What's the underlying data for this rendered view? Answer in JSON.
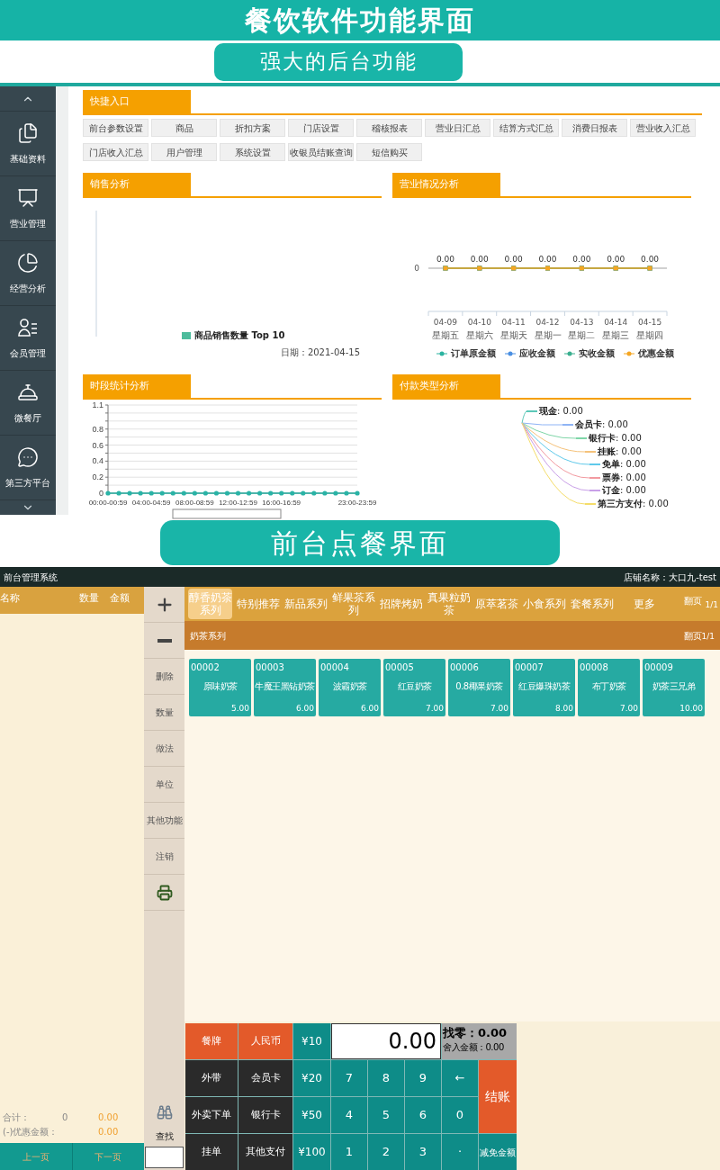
{
  "banner": {
    "title": "餐饮软件功能界面"
  },
  "backoffice_heading": "强大的后台功能",
  "backoffice": {
    "sidebar": {
      "items": [
        {
          "label": "基础资料",
          "kind": "files"
        },
        {
          "label": "营业管理",
          "kind": "board"
        },
        {
          "label": "经营分析",
          "kind": "pie"
        },
        {
          "label": "会员管理",
          "kind": "members"
        },
        {
          "label": "微餐厅",
          "kind": "cloche"
        },
        {
          "label": "第三方平台",
          "kind": "chat"
        }
      ]
    },
    "quick_entry": {
      "title": "快捷入口",
      "buttons": [
        "前台参数设置",
        "商品",
        "折扣方案",
        "门店设置",
        "稽核报表",
        "营业日汇总",
        "结算方式汇总",
        "消费日报表",
        "营业收入汇总",
        "门店收入汇总",
        "用户管理",
        "系统设置",
        "收银员结账查询",
        "短信购买"
      ]
    },
    "sales_analysis": {
      "title": "销售分析",
      "legend": "商品销售数量 Top 10",
      "date": "日期：2021-04-15"
    },
    "business_analysis": {
      "title": "营业情况分析",
      "y_tick": "0",
      "weekdays": [
        "星期五",
        "星期六",
        "星期天",
        "星期一",
        "星期二",
        "星期三",
        "星期四"
      ],
      "dates": [
        "04-09",
        "04-10",
        "04-11",
        "04-12",
        "04-13",
        "04-14",
        "04-15"
      ],
      "value_labels": [
        "0.00",
        "0.00",
        "0.00",
        "0.00",
        "0.00",
        "0.00",
        "0.00"
      ],
      "legend": [
        {
          "name": "订单原金额",
          "color": "#2bb3a0"
        },
        {
          "name": "应收金额",
          "color": "#4a8fe2"
        },
        {
          "name": "实收金额",
          "color": "#3aaf8f"
        },
        {
          "name": "优惠金额",
          "color": "#f5a623"
        }
      ]
    },
    "time_analysis": {
      "title": "时段统计分析",
      "chart_data": {
        "type": "line",
        "grid": true,
        "ylim": [
          0,
          1.1
        ],
        "yticks": [
          0,
          0.2,
          0.4,
          0.6,
          0.8,
          1.1
        ],
        "categories": [
          "00:00-00:59",
          null,
          null,
          null,
          "04:00-04:59",
          null,
          null,
          null,
          "08:00-08:59",
          null,
          null,
          null,
          "12:00-12:59",
          null,
          null,
          null,
          "16:00-16:59",
          null,
          null,
          null,
          null,
          null,
          null,
          "23:00-23:59"
        ],
        "series": [
          {
            "color": "#2ab3a6",
            "values": [
              0,
              0,
              0,
              0,
              0,
              0,
              0,
              0,
              0,
              0,
              0,
              0,
              0,
              0,
              0,
              0,
              0,
              0,
              0,
              0,
              0,
              0,
              0,
              0
            ]
          }
        ]
      }
    },
    "payment_analysis": {
      "title": "付款类型分析",
      "items": [
        {
          "label": "**现金**: 0.00",
          "color": "#5cc8b8"
        },
        {
          "label": "**会员卡**: 0.00",
          "color": "#8fb4f5"
        },
        {
          "label": "**银行卡**: 0.00",
          "color": "#7fd6a8"
        },
        {
          "label": "**挂账**: 0.00",
          "color": "#f5c27a"
        },
        {
          "label": "**免单**: 0.00",
          "color": "#5fc9ea"
        },
        {
          "label": "**票券**: 0.00",
          "color": "#f29aa0"
        },
        {
          "label": "**订金**: 0.00",
          "color": "#c9a0e8"
        },
        {
          "label": "**第三方支付**: 0.00",
          "color": "#f5dd6a"
        }
      ]
    }
  },
  "frontdesk_heading": "前台点餐界面",
  "pos": {
    "title": "前台管理系统",
    "store": "店铺名称：大口九-test",
    "order_list": {
      "columns": [
        "名称",
        "数量",
        "金额"
      ],
      "total_label": "合计：",
      "total_count": "0",
      "total_amount": "0.00",
      "discount_label": "(-)优惠金额：",
      "discount_amount": "0.00",
      "prev": "上一页",
      "next": "下一页"
    },
    "tools": [
      {
        "kind": "plus"
      },
      {
        "kind": "minus"
      },
      {
        "kind": "text",
        "label": "删除"
      },
      {
        "kind": "text",
        "label": "数量"
      },
      {
        "kind": "text",
        "label": "做法"
      },
      {
        "kind": "text",
        "label": "单位"
      },
      {
        "kind": "text",
        "label": "其他功能"
      },
      {
        "kind": "text",
        "label": "注销"
      },
      {
        "kind": "print"
      }
    ],
    "search": {
      "label": "查找"
    },
    "categories": [
      {
        "label": "醇香奶茶系列",
        "selected": true
      },
      {
        "label": "特别推荐",
        "selected": false
      },
      {
        "label": "新品系列",
        "selected": false
      },
      {
        "label": "鲜果茶系列",
        "selected": false
      },
      {
        "label": "招牌烤奶",
        "selected": false
      },
      {
        "label": "真果粒奶茶",
        "selected": false
      },
      {
        "label": "原萃茗茶",
        "selected": false
      },
      {
        "label": "小食系列",
        "selected": false
      },
      {
        "label": "套餐系列",
        "selected": false
      }
    ],
    "more": "更多",
    "page_label": "翻页",
    "page": "1/1",
    "subcategory": {
      "label": "奶茶系列",
      "page_label": "翻页",
      "page": "1/1"
    },
    "products": [
      {
        "code": "00002",
        "name": "原味奶茶",
        "price": "5.00"
      },
      {
        "code": "00003",
        "name": "牛魔王黑钻奶茶",
        "price": "6.00"
      },
      {
        "code": "00004",
        "name": "波霸奶茶",
        "price": "6.00"
      },
      {
        "code": "00005",
        "name": "红豆奶茶",
        "price": "7.00"
      },
      {
        "code": "00006",
        "name": "0.8椰果奶茶",
        "price": "7.00"
      },
      {
        "code": "00007",
        "name": "红豆爆珠奶茶",
        "price": "8.00"
      },
      {
        "code": "00008",
        "name": "布丁奶茶",
        "price": "7.00"
      },
      {
        "code": "00009",
        "name": "奶茶三兄弟",
        "price": "10.00"
      }
    ],
    "keypad": {
      "order_types": [
        {
          "label": "餐牌",
          "selected": true
        },
        {
          "label": "外带",
          "selected": false
        },
        {
          "label": "外卖下单",
          "selected": false
        },
        {
          "label": "挂单",
          "selected": false
        }
      ],
      "payment_methods": [
        {
          "label": "人民币",
          "selected": true
        },
        {
          "label": "会员卡",
          "selected": false
        },
        {
          "label": "银行卡",
          "selected": false
        },
        {
          "label": "其他支付",
          "selected": false
        }
      ],
      "cash_amounts": [
        "¥10",
        "¥20",
        "¥50",
        "¥100"
      ],
      "display": "0.00",
      "change": "找零：0.00",
      "rounding": "舍入金额：0.00",
      "keys": [
        "7",
        "8",
        "9",
        "←",
        "4",
        "5",
        "6",
        "0",
        "1",
        "2",
        "3",
        "·"
      ],
      "checkout": "结账",
      "discount": "减免金额"
    }
  }
}
